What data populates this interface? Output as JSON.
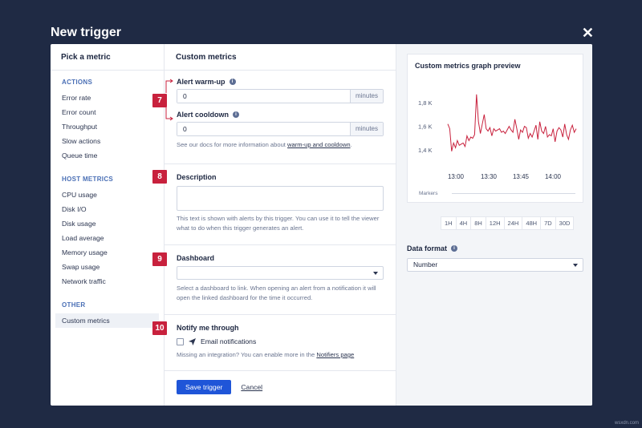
{
  "modal": {
    "title": "New trigger"
  },
  "sidebar": {
    "heading": "Pick a metric",
    "sections": [
      {
        "title": "ACTIONS",
        "items": [
          "Error rate",
          "Error count",
          "Throughput",
          "Slow actions",
          "Queue time"
        ]
      },
      {
        "title": "HOST METRICS",
        "items": [
          "CPU usage",
          "Disk I/O",
          "Disk usage",
          "Load average",
          "Memory usage",
          "Swap usage",
          "Network traffic"
        ]
      },
      {
        "title": "OTHER",
        "items": [
          "Custom metrics"
        ]
      }
    ],
    "active_item": "Custom metrics"
  },
  "main": {
    "heading": "Custom metrics",
    "warmup": {
      "label": "Alert warm-up",
      "value": "0",
      "suffix": "minutes",
      "badge": "7"
    },
    "cooldown": {
      "label": "Alert cooldown",
      "value": "0",
      "suffix": "minutes"
    },
    "docs_help": {
      "prefix": "See our docs for more information about ",
      "link": "warm-up and cooldown",
      "suffix": "."
    },
    "description": {
      "label": "Description",
      "badge": "8",
      "value": "",
      "help": "This text is shown with alerts by this trigger. You can use it to tell the viewer what to do when this trigger generates an alert."
    },
    "dashboard": {
      "label": "Dashboard",
      "badge": "9",
      "value": "",
      "help": "Select a dashboard to link. When opening an alert from a notification it will open the linked dashboard for the time it occurred."
    },
    "notify": {
      "label": "Notify me through",
      "badge": "10",
      "option": "Email notifications",
      "checked": false,
      "help_prefix": "Missing an integration? You can enable more in the ",
      "help_link": "Notifiers page"
    },
    "save_label": "Save trigger",
    "cancel_label": "Cancel"
  },
  "preview": {
    "title": "Custom metrics graph preview",
    "markers_label": "Markers",
    "ranges": [
      "1H",
      "4H",
      "8H",
      "12H",
      "24H",
      "48H",
      "7D",
      "30D"
    ],
    "data_format_label": "Data format",
    "data_format_value": "Number"
  },
  "chart_data": {
    "type": "line",
    "x_ticks": [
      "13:00",
      "13:30",
      "13:45",
      "14:00"
    ],
    "y_ticks": [
      "1,8 K",
      "1,6 K",
      "1,4 K"
    ],
    "ylim": [
      1300,
      1950
    ],
    "values": [
      1620,
      1580,
      1390,
      1460,
      1420,
      1480,
      1440,
      1450,
      1460,
      1430,
      1520,
      1480,
      1510,
      1500,
      1530,
      1870,
      1640,
      1540,
      1620,
      1700,
      1580,
      1560,
      1590,
      1520,
      1580,
      1560,
      1570,
      1580,
      1550,
      1560,
      1540,
      1570,
      1600,
      1570,
      1550,
      1660,
      1580,
      1490,
      1570,
      1550,
      1600,
      1590,
      1500,
      1540,
      1510,
      1560,
      1610,
      1490,
      1640,
      1560,
      1540,
      1600,
      1510,
      1530,
      1520,
      1580,
      1470,
      1560,
      1590,
      1570,
      1510,
      1620,
      1530,
      1490,
      1570,
      1610,
      1550,
      1580
    ],
    "grid": false,
    "color": "#c8213d"
  },
  "colors": {
    "primary": "#1f55d8",
    "badge": "#c8213d",
    "backdrop": "#1f2a44"
  },
  "watermark": "wsxdn.com"
}
